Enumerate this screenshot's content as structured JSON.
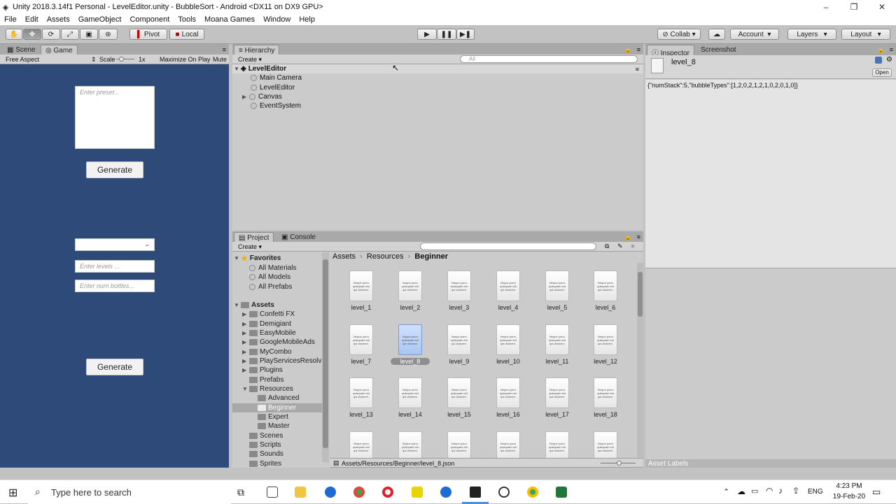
{
  "window": {
    "title": "Unity 2018.3.14f1 Personal - LevelEditor.unity - BubbleSort - Android <DX11 on DX9 GPU>"
  },
  "menu": [
    "File",
    "Edit",
    "Assets",
    "GameObject",
    "Component",
    "Tools",
    "Moana Games",
    "Window",
    "Help"
  ],
  "toolbar": {
    "pivot": "Pivot",
    "local": "Local",
    "collab": "Collab",
    "account": "Account",
    "layers": "Layers",
    "layout": "Layout"
  },
  "scene_tabs": {
    "scene": "Scene",
    "game": "Game"
  },
  "game_bar": {
    "aspect": "Free Aspect",
    "scale_label": "Scale",
    "scale_value": "1x",
    "maximize": "Maximize On Play",
    "mute": "Mute"
  },
  "game_ui": {
    "preset_placeholder": "Enter preset...",
    "generate1": "Generate",
    "levels_placeholder": "Enter levels ...",
    "bottles_placeholder": "Enter num bottles...",
    "generate2": "Generate"
  },
  "hierarchy": {
    "tab": "Hierarchy",
    "create": "Create",
    "search_placeholder": "All",
    "scene": "LevelEditor",
    "items": [
      "Main Camera",
      "LevelEditor",
      "Canvas",
      "EventSystem"
    ]
  },
  "project": {
    "tab": "Project",
    "console_tab": "Console",
    "create": "Create",
    "favorites": "Favorites",
    "favorites_items": [
      "All Materials",
      "All Models",
      "All Prefabs"
    ],
    "assets": "Assets",
    "assets_items": [
      "Confetti FX",
      "Demigiant",
      "EasyMobile",
      "GoogleMobileAds",
      "MyCombo",
      "PlayServicesResolv",
      "Plugins",
      "Prefabs",
      "Resources"
    ],
    "resources_items": [
      "Advanced",
      "Beginner",
      "Expert",
      "Master"
    ],
    "after_items": [
      "Scenes",
      "Scripts",
      "Sounds",
      "Sprites"
    ],
    "breadcrumb": [
      "Assets",
      "Resources",
      "Beginner"
    ],
    "files": [
      "level_1",
      "level_2",
      "level_3",
      "level_4",
      "level_5",
      "level_6",
      "level_7",
      "level_8",
      "level_9",
      "level_10",
      "level_11",
      "level_12",
      "level_13",
      "level_14",
      "level_15",
      "level_16",
      "level_17",
      "level_18",
      "",
      "",
      "",
      "",
      "",
      ""
    ],
    "doc_preview": "Neque porro quisquam est qui dolorem.",
    "path": "Assets/Resources/Beginner/level_8.json"
  },
  "inspector": {
    "tab": "Inspector",
    "screenshot_tab": "Screenshot",
    "asset_name": "level_8",
    "open": "Open",
    "content": "{\"numStack\":5,\"bubbleTypes\":[1,2,0,2,1,2,1,0,2,0,1,0]}",
    "labels": "Asset Labels"
  },
  "taskbar": {
    "search": "Type here to search",
    "lang": "ENG",
    "time": "4:23 PM",
    "date": "19-Feb-20"
  }
}
